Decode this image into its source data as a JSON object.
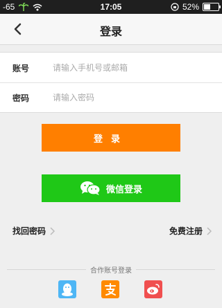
{
  "status_bar": {
    "signal": "-65",
    "time": "17:05",
    "battery": "52%",
    "battery_level": 0.52
  },
  "nav": {
    "title": "登录"
  },
  "form": {
    "account_label": "账号",
    "account_placeholder": "请输入手机号或邮箱",
    "password_label": "密码",
    "password_placeholder": "请输入密码"
  },
  "buttons": {
    "login": "登录",
    "wechat_login": "微信登录"
  },
  "links": {
    "forgot_password": "找回密码",
    "register": "免费注册"
  },
  "partner": {
    "label": "合作账号登录",
    "items": [
      {
        "name": "qq-icon",
        "color": "#4eb6f5"
      },
      {
        "name": "alipay-icon",
        "color": "#ff8a00"
      },
      {
        "name": "weibo-icon",
        "color": "#f04f4f"
      }
    ]
  },
  "colors": {
    "login_button": "#ff7f00",
    "wechat_button": "#1fc817"
  }
}
